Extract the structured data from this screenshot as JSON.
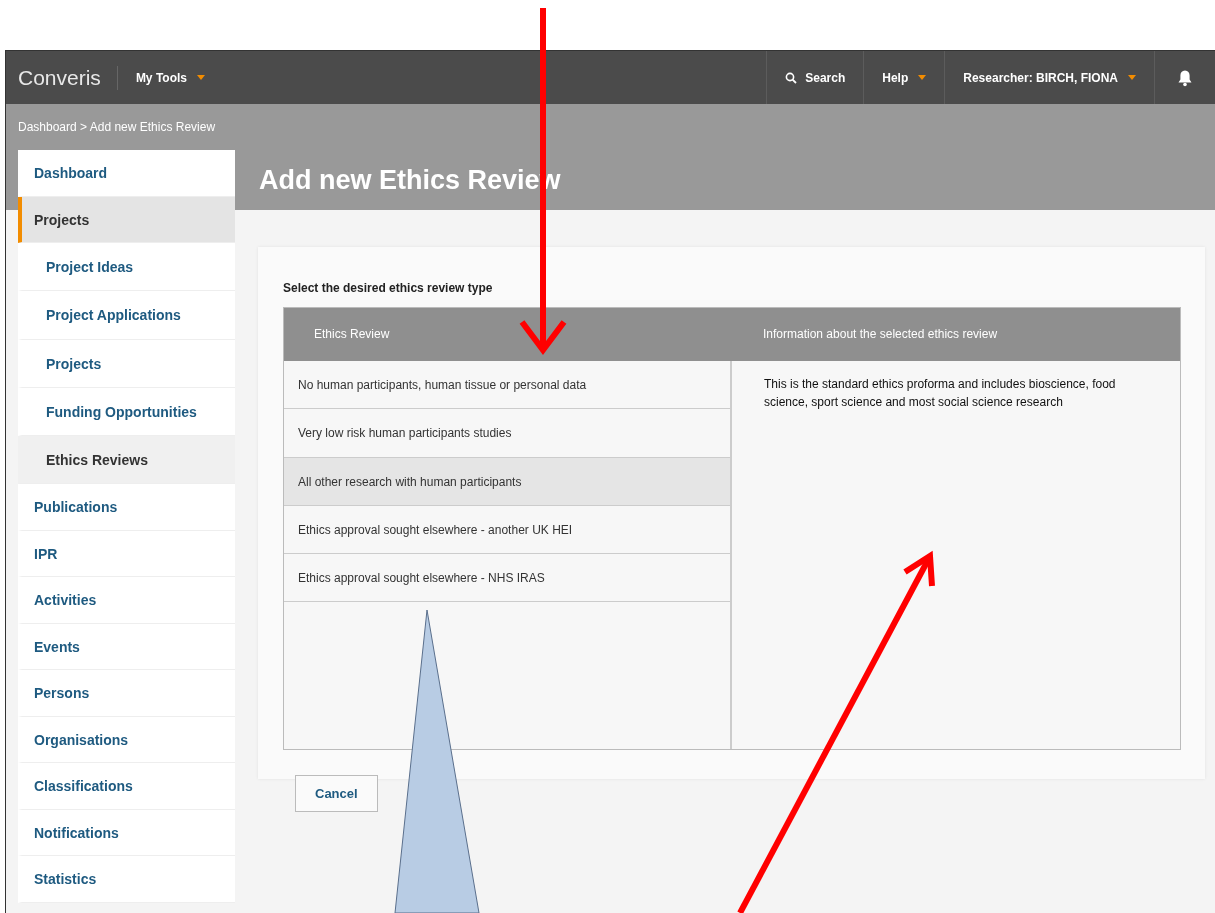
{
  "topbar": {
    "logo": "Converis",
    "my_tools": "My Tools",
    "search": "Search",
    "help": "Help",
    "user": "Researcher: BIRCH, FIONA"
  },
  "breadcrumb": "Dashboard > Add new Ethics Review",
  "page_title": "Add new Ethics Review",
  "sidebar": {
    "items": [
      {
        "label": "Dashboard",
        "selected": false
      },
      {
        "label": "Projects",
        "selected": true,
        "children": [
          {
            "label": "Project Ideas",
            "selected": false
          },
          {
            "label": "Project Applications",
            "selected": false
          },
          {
            "label": "Projects",
            "selected": false
          },
          {
            "label": "Funding Opportunities",
            "selected": false
          },
          {
            "label": "Ethics Reviews",
            "selected": true
          }
        ]
      },
      {
        "label": "Publications",
        "selected": false
      },
      {
        "label": "IPR",
        "selected": false
      },
      {
        "label": "Activities",
        "selected": false
      },
      {
        "label": "Events",
        "selected": false
      },
      {
        "label": "Persons",
        "selected": false
      },
      {
        "label": "Organisations",
        "selected": false
      },
      {
        "label": "Classifications",
        "selected": false
      },
      {
        "label": "Notifications",
        "selected": false
      },
      {
        "label": "Statistics",
        "selected": false
      }
    ]
  },
  "form": {
    "prompt": "Select the desired ethics review type",
    "columns": [
      "Ethics Review",
      "Information about the selected ethics review"
    ],
    "options": [
      {
        "label": "No human participants, human tissue or personal data",
        "selected": false
      },
      {
        "label": "Very low risk human participants studies",
        "selected": false
      },
      {
        "label": "All other research with human participants",
        "selected": true
      },
      {
        "label": "Ethics approval sought elsewhere - another UK HEI",
        "selected": false
      },
      {
        "label": "Ethics approval sought elsewhere - NHS IRAS",
        "selected": false
      }
    ],
    "info": "This is the standard ethics proforma and includes bioscience, food science, sport science and most social science research",
    "cancel": "Cancel"
  }
}
